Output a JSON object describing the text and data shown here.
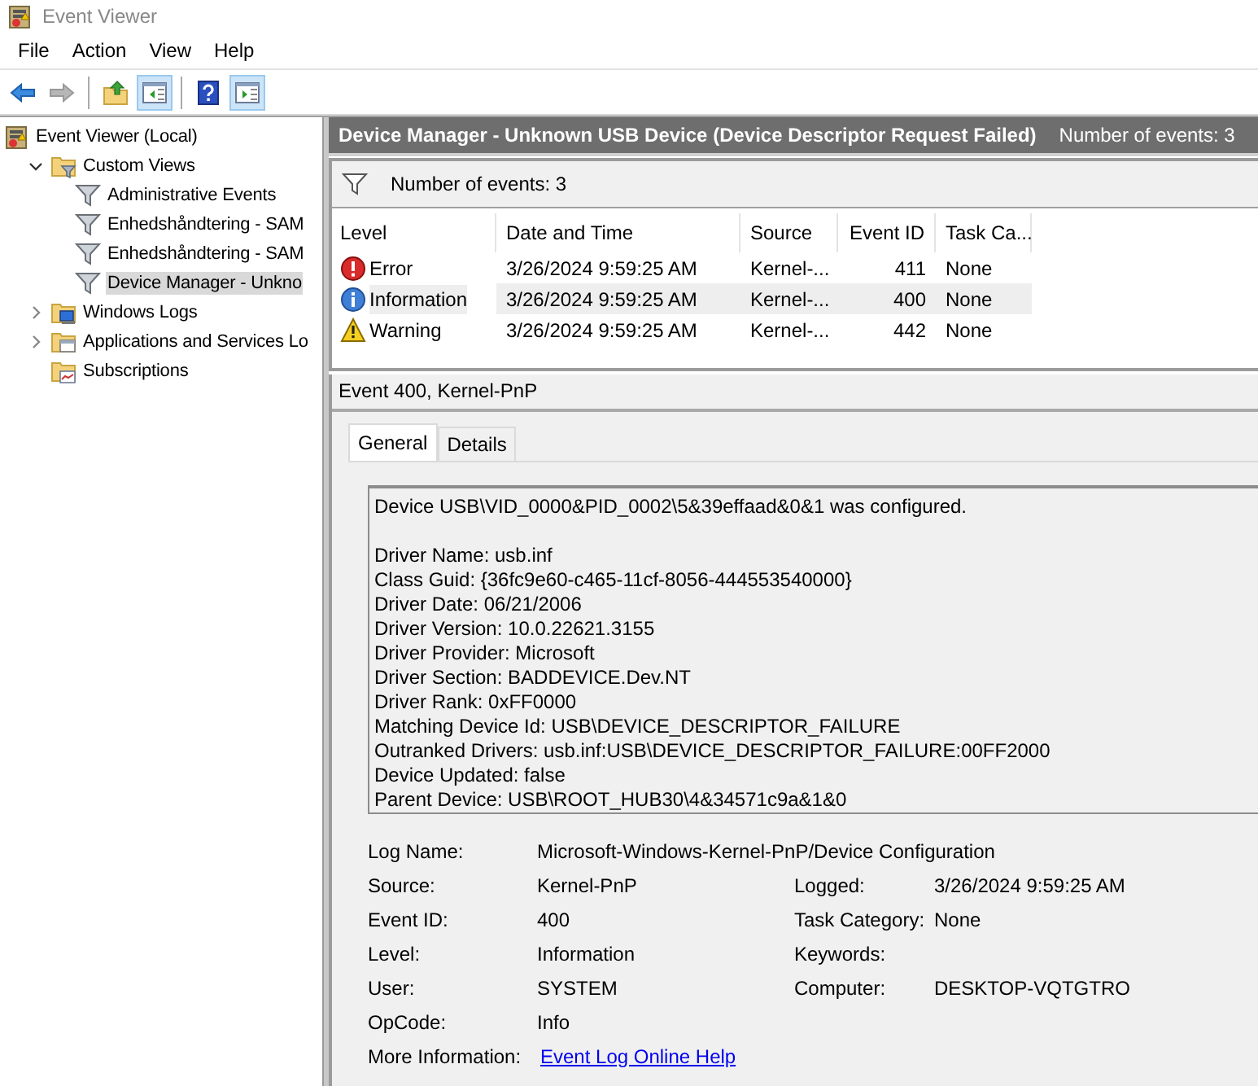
{
  "window": {
    "title": "Event Viewer"
  },
  "menu": [
    "File",
    "Action",
    "View",
    "Help"
  ],
  "toolbar": [
    {
      "kind": "back",
      "disabled": false,
      "pressed": false
    },
    {
      "kind": "forward",
      "disabled": true,
      "pressed": false
    },
    {
      "kind": "up",
      "disabled": false,
      "pressed": false
    },
    {
      "kind": "pane-left",
      "disabled": false,
      "pressed": true
    },
    {
      "kind": "help",
      "disabled": false,
      "pressed": false
    },
    {
      "kind": "pane-right",
      "disabled": false,
      "pressed": true
    }
  ],
  "tree": [
    {
      "label": "Event Viewer (Local)",
      "kind": "root",
      "selected": false,
      "children": [
        {
          "label": "Custom Views",
          "kind": "folder-filter",
          "expanded": true,
          "selected": false,
          "children": [
            {
              "label": "Administrative Events",
              "kind": "filter",
              "selected": false
            },
            {
              "label": "Enhedshåndtering - SAM",
              "kind": "filter",
              "selected": false
            },
            {
              "label": "Enhedshåndtering - SAM",
              "kind": "filter",
              "selected": false
            },
            {
              "label": "Device Manager - Unkno",
              "kind": "filter",
              "selected": true
            }
          ]
        },
        {
          "label": "Windows Logs",
          "kind": "folder-logs",
          "expanded": false,
          "selected": false
        },
        {
          "label": "Applications and Services Lo",
          "kind": "folder",
          "expanded": false,
          "selected": false
        },
        {
          "label": "Subscriptions",
          "kind": "folder-subs",
          "selected": false
        }
      ]
    }
  ],
  "header": {
    "title": "Device Manager - Unknown USB Device (Device Descriptor Request Failed)",
    "count": "Number of events: 3"
  },
  "filter_bar": {
    "text": "Number of events: 3"
  },
  "table": {
    "columns": [
      "Level",
      "Date and Time",
      "Source",
      "Event ID",
      "Task Ca..."
    ],
    "rows": [
      {
        "kind": "error",
        "cells": [
          "Error",
          "3/26/2024 9:59:25 AM",
          "Kernel-...",
          "411",
          "None"
        ],
        "selected": false
      },
      {
        "kind": "information",
        "cells": [
          "Information",
          "3/26/2024 9:59:25 AM",
          "Kernel-...",
          "400",
          "None"
        ],
        "selected": true
      },
      {
        "kind": "warning",
        "cells": [
          "Warning",
          "3/26/2024 9:59:25 AM",
          "Kernel-...",
          "442",
          "None"
        ],
        "selected": false
      }
    ]
  },
  "event": {
    "title": "Event 400, Kernel-PnP",
    "tabs": [
      {
        "label": "General",
        "selected": true
      },
      {
        "label": "Details",
        "selected": false
      }
    ],
    "message": "Device USB\\VID_0000&PID_0002\\5&39effaad&0&1 was configured.",
    "properties": [
      "Driver Name: usb.inf",
      "Class Guid: {36fc9e60-c465-11cf-8056-444553540000}",
      "Driver Date: 06/21/2006",
      "Driver Version: 10.0.22621.3155",
      "Driver Provider: Microsoft",
      "Driver Section: BADDEVICE.Dev.NT",
      "Driver Rank: 0xFF0000",
      "Matching Device Id: USB\\DEVICE_DESCRIPTOR_FAILURE",
      "Outranked Drivers: usb.inf:USB\\DEVICE_DESCRIPTOR_FAILURE:00FF2000",
      "Device Updated: false",
      "Parent Device: USB\\ROOT_HUB30\\4&34571c9a&1&0"
    ],
    "fields": [
      {
        "label": "Log Name:",
        "value": "Microsoft-Windows-Kernel-PnP/Device Configuration",
        "kind": "wide"
      },
      {
        "label": "Source:",
        "value": "Kernel-PnP",
        "kind": "text"
      },
      {
        "label": "Logged:",
        "value": "3/26/2024 9:59:25 AM",
        "kind": "text"
      },
      {
        "label": "Event ID:",
        "value": "400",
        "kind": "text"
      },
      {
        "label": "Task Category:",
        "value": "None",
        "kind": "text"
      },
      {
        "label": "Level:",
        "value": "Information",
        "kind": "text"
      },
      {
        "label": "Keywords:",
        "kind": "text"
      },
      {
        "label": "User:",
        "value": "SYSTEM",
        "kind": "text"
      },
      {
        "label": "Computer:",
        "value": "DESKTOP-VQTGTRO",
        "kind": "text"
      },
      {
        "label": "OpCode:",
        "value": "Info",
        "kind": "wide"
      },
      {
        "label": "More Information:",
        "value": "Event Log Online Help",
        "kind": "link"
      }
    ]
  }
}
